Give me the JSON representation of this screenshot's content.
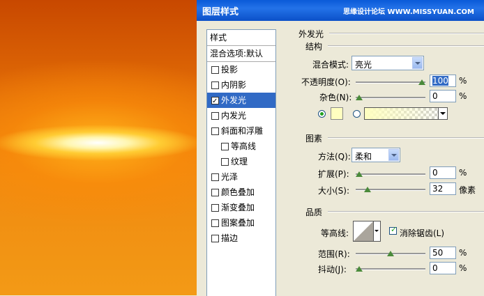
{
  "dialog": {
    "title": "图层样式",
    "watermark": "思缘设计论坛 WWW.MISSYUAN.COM"
  },
  "left": {
    "header": "样式",
    "blending": "混合选项:默认",
    "items": [
      {
        "label": "投影",
        "checked": false,
        "sub": false,
        "selected": false
      },
      {
        "label": "内阴影",
        "checked": false,
        "sub": false,
        "selected": false
      },
      {
        "label": "外发光",
        "checked": true,
        "sub": false,
        "selected": true
      },
      {
        "label": "内发光",
        "checked": false,
        "sub": false,
        "selected": false
      },
      {
        "label": "斜面和浮雕",
        "checked": false,
        "sub": false,
        "selected": false
      },
      {
        "label": "等高线",
        "checked": false,
        "sub": true,
        "selected": false
      },
      {
        "label": "纹理",
        "checked": false,
        "sub": true,
        "selected": false
      },
      {
        "label": "光泽",
        "checked": false,
        "sub": false,
        "selected": false
      },
      {
        "label": "颜色叠加",
        "checked": false,
        "sub": false,
        "selected": false
      },
      {
        "label": "渐变叠加",
        "checked": false,
        "sub": false,
        "selected": false
      },
      {
        "label": "图案叠加",
        "checked": false,
        "sub": false,
        "selected": false
      },
      {
        "label": "描边",
        "checked": false,
        "sub": false,
        "selected": false
      }
    ]
  },
  "outer_glow": {
    "title": "外发光",
    "structure": {
      "title": "结构",
      "blend_mode_label": "混合模式:",
      "blend_mode_value": "亮光",
      "opacity_label": "不透明度(O):",
      "opacity_value": "100",
      "opacity_pct": 100,
      "noise_label": "杂色(N):",
      "noise_value": "0",
      "noise_pct": 0,
      "unit": "%",
      "glow_color": "#ffffc0",
      "color_mode": "solid"
    },
    "elements": {
      "title": "图素",
      "technique_label": "方法(Q):",
      "technique_value": "柔和",
      "spread_label": "扩展(P):",
      "spread_value": "0",
      "spread_pct": 0,
      "size_label": "大小(S):",
      "size_value": "32",
      "size_unit": "像素",
      "unit": "%"
    },
    "quality": {
      "title": "品质",
      "contour_label": "等高线:",
      "antialias_label": "消除锯齿(L)",
      "antialias_checked": true,
      "range_label": "范围(R):",
      "range_value": "50",
      "range_pct": 50,
      "jitter_label": "抖动(J):",
      "jitter_value": "0",
      "jitter_pct": 0,
      "unit": "%"
    }
  }
}
